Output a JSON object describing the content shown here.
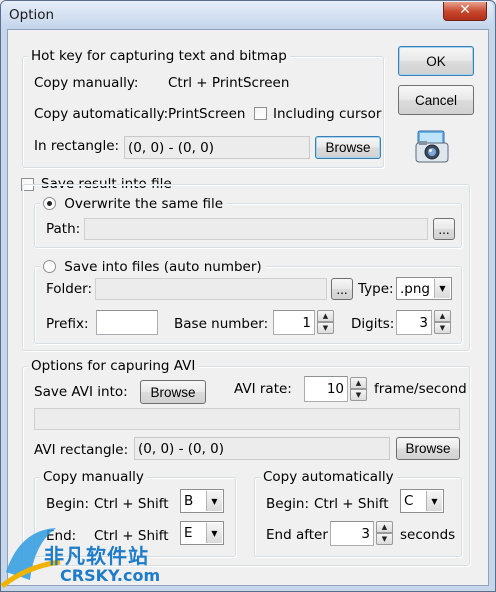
{
  "window": {
    "title": "Option",
    "close_glyph": "✕"
  },
  "buttons": {
    "ok": "OK",
    "cancel": "Cancel"
  },
  "camera_icon": "camera-icon",
  "hotkey": {
    "group_label": "Hot key for capturing text and bitmap",
    "copy_manually_label": "Copy manually:",
    "copy_manually_value": "Ctrl + PrintScreen",
    "copy_auto_label": "Copy automatically:",
    "copy_auto_value": "PrintScreen",
    "including_cursor_label": "Including cursor",
    "including_cursor_checked": false,
    "rect_label": "In rectangle:",
    "rect_value": "(0, 0) - (0, 0)",
    "browse_label": "Browse"
  },
  "save_file": {
    "checkbox_label": "Save result into file",
    "checked": false,
    "overwrite": {
      "label": "Overwrite the same file",
      "selected": true,
      "path_label": "Path:",
      "path_value": "",
      "browse_label": "..."
    },
    "auto": {
      "label": "Save into files (auto number)",
      "selected": false,
      "folder_label": "Folder:",
      "folder_value": "",
      "browse_label": "...",
      "type_label": "Type:",
      "type_value": ".png",
      "prefix_label": "Prefix:",
      "prefix_value": "",
      "base_label": "Base number:",
      "base_value": "1",
      "digits_label": "Digits:",
      "digits_value": "3"
    }
  },
  "avi": {
    "group_label": "Options for capuring AVI",
    "save_into_label": "Save AVI into:",
    "browse_label": "Browse",
    "rate_label": "AVI rate:",
    "rate_value": "10",
    "rate_unit": "frame/second",
    "path_value": "",
    "rect_label": "AVI rectangle:",
    "rect_value": "(0, 0) - (0, 0)",
    "rect_browse_label": "Browse",
    "manual": {
      "group_label": "Copy manually",
      "begin_label": "Begin:",
      "begin_mod": "Ctrl + Shift",
      "begin_key": "B",
      "end_label": "End:",
      "end_mod": "Ctrl + Shift",
      "end_key": "E"
    },
    "automatic": {
      "group_label": "Copy automatically",
      "begin_label": "Begin:",
      "begin_mod": "Ctrl + Shift",
      "begin_key": "C",
      "end_after_label": "End after",
      "end_after_value": "3",
      "end_after_unit": "seconds"
    }
  },
  "watermark": {
    "cn": "非凡软件站",
    "en": "CRSKY.com"
  }
}
